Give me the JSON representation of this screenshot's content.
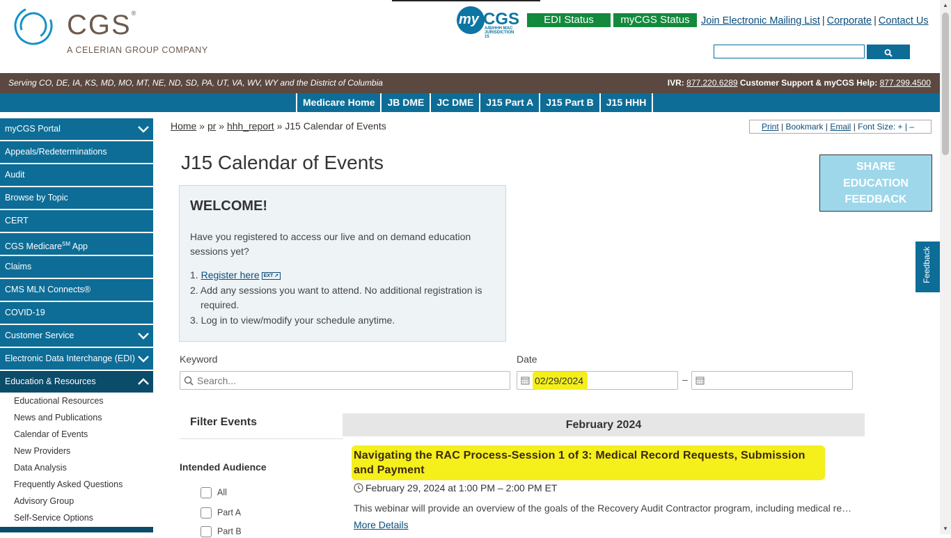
{
  "header": {
    "logo_text": "CGS",
    "logo_reg": "®",
    "logo_sub": "A CELERIAN GROUP COMPANY",
    "mycgs_my": "my",
    "mycgs_cgs": "CGS",
    "mycgs_sub": "A/B/HHH MAC  JURISDICTION 15",
    "edi_status": "EDI Status",
    "mycgs_status": "myCGS Status",
    "links": [
      "Join Electronic Mailing List",
      "Corporate",
      "Contact Us"
    ],
    "link_sep": "|",
    "search_placeholder": ""
  },
  "servebar": {
    "serving": "Serving CO, DE, IA, KS, MD, MO, MT, NE, ND, SD, PA, UT, VA, WV, WY and the District of Columbia",
    "ivr_label": "IVR:",
    "ivr_number": "877.220.6289",
    "support_label": "Customer Support & myCGS Help:",
    "support_number": "877.299.4500"
  },
  "nav": {
    "items": [
      "Medicare Home",
      "JB DME",
      "JC DME",
      "J15 Part A",
      "J15 Part B",
      "J15 HHH"
    ]
  },
  "sidebar": {
    "items": [
      {
        "label": "myCGS Portal",
        "expandable": true
      },
      {
        "label": "Appeals/Redeterminations"
      },
      {
        "label": "Audit"
      },
      {
        "label": "Browse by Topic"
      },
      {
        "label": "CERT"
      },
      {
        "label": "CGS Medicare",
        "sup": "SM",
        "suffix": " App"
      },
      {
        "label": "Claims"
      },
      {
        "label": "CMS MLN Connects®"
      },
      {
        "label": "COVID-19"
      },
      {
        "label": "Customer Service",
        "expandable": true
      },
      {
        "label": "Electronic Data Interchange (EDI)",
        "expandable": true
      },
      {
        "label": "Education & Resources",
        "expanded": true
      }
    ],
    "subitems": [
      "Educational Resources",
      "News and Publications",
      "Calendar of Events",
      "New Providers",
      "Data Analysis",
      "Frequently Asked Questions",
      "Advisory Group",
      "Self-Service Options"
    ]
  },
  "breadcrumb": {
    "home": "Home",
    "pr": "pr",
    "hhh_report": "hhh_report",
    "current": "J15 Calendar of Events",
    "sep": "»"
  },
  "tools": {
    "print": "Print",
    "bookmark": "Bookmark",
    "email": "Email",
    "font_size": "Font Size: + | –",
    "sep": "|"
  },
  "page_title": "J15 Calendar of Events",
  "share": {
    "line1": "SHARE",
    "line2": "EDUCATION",
    "line3": "FEEDBACK"
  },
  "feedback_tab": "Feedback",
  "welcome": {
    "title": "WELCOME!",
    "intro": "Have you registered to access our live and on demand education sessions yet?",
    "step1_num": "1.",
    "step1_link": "Register here",
    "step1_ext": "EXT ↗",
    "step2": "2. Add any sessions you want to attend. No additional registration is required.",
    "step3": "3. Log in to view/modify your schedule anytime."
  },
  "filters": {
    "keyword_label": "Keyword",
    "keyword_placeholder": "Search...",
    "date_label": "Date",
    "date_from": "02/29/2024",
    "date_dash": "–",
    "date_to": ""
  },
  "filter_events": {
    "title": "Filter Events",
    "audience_title": "Intended Audience",
    "options": [
      "All",
      "Part A",
      "Part B"
    ]
  },
  "calendar": {
    "month": "February 2024",
    "event": {
      "title": "Navigating the RAC Process-Session 1 of 3: Medical Record Requests, Submission and Payment",
      "time": "February 29, 2024 at 1:00 PM – 2:00 PM ET",
      "desc": "This webinar will provide an overview of the goals of the Recovery Audit Contractor program, including medical record requests",
      "more": "More Details"
    }
  },
  "colors": {
    "primary_blue": "#0d6d97",
    "brown": "#5b4840",
    "green": "#138a3c",
    "highlight": "#f5ef1b",
    "share_bg": "#9fd7ea"
  }
}
